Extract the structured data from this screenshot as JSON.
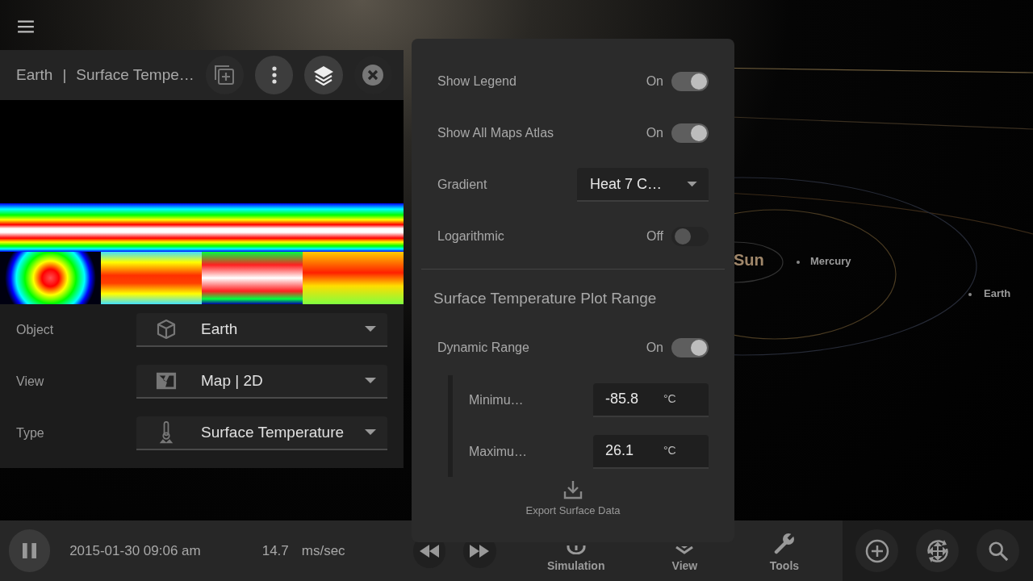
{
  "map_panel": {
    "title": "Earth",
    "separator": "|",
    "subtitle": "Surface Tempe…",
    "fields": [
      {
        "kind": "cube",
        "label": "Object",
        "value": "Earth"
      },
      {
        "kind": "map",
        "label": "View",
        "value": "Map | 2D"
      },
      {
        "kind": "thermometer",
        "label": "Type",
        "value": "Surface Temperature"
      }
    ]
  },
  "settings": {
    "rows": [
      {
        "kind": "toggle",
        "label": "Show Legend",
        "state_text": "On",
        "on": true
      },
      {
        "kind": "toggle",
        "label": "Show All Maps Atlas",
        "state_text": "On",
        "on": true
      },
      {
        "kind": "select",
        "label": "Gradient",
        "value": "Heat 7 C…"
      },
      {
        "kind": "toggle",
        "label": "Logarithmic",
        "state_text": "Off",
        "on": false
      }
    ],
    "section_title": "Surface Temperature Plot Range",
    "dynamic_range": {
      "label": "Dynamic Range",
      "state_text": "On",
      "on": true
    },
    "range_fields": [
      {
        "label": "Minimu…",
        "value": "-85.8",
        "unit": "°C"
      },
      {
        "label": "Maximu…",
        "value": "26.1",
        "unit": "°C"
      }
    ],
    "export_label": "Export Surface Data"
  },
  "scene_labels": [
    {
      "kind": "star",
      "text": "Sun"
    },
    {
      "kind": "planet",
      "text": "Mercury"
    },
    {
      "kind": "planet",
      "text": "Earth"
    }
  ],
  "status_bar": {
    "datetime": "2015-01-30 09:06 am",
    "rate": "14.7",
    "rate_unit": "ms/sec",
    "nav": [
      {
        "kind": "simulation",
        "label": "Simulation"
      },
      {
        "kind": "view",
        "label": "View"
      },
      {
        "kind": "tools",
        "label": "Tools"
      }
    ]
  }
}
